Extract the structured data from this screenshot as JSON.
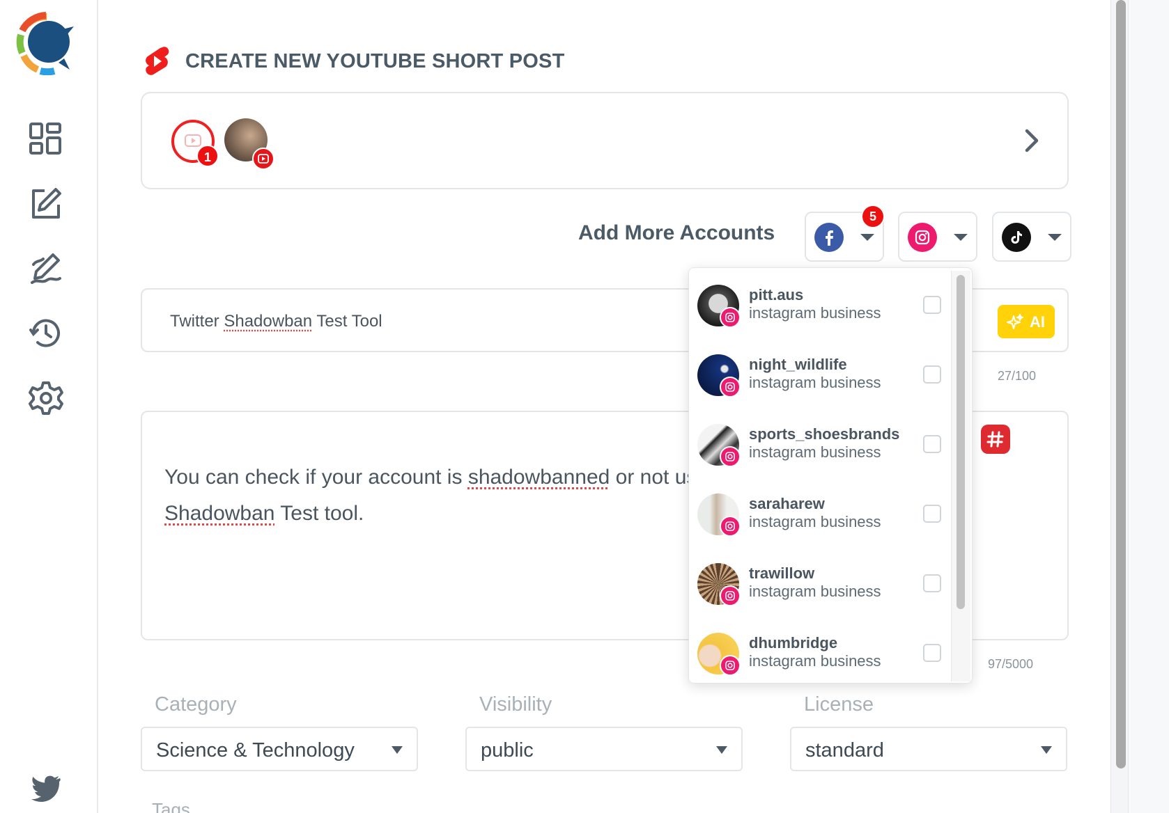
{
  "sidebar": {
    "icons": [
      "dashboard-icon",
      "compose-icon",
      "drafts-icon",
      "history-icon",
      "settings-icon",
      "twitter-icon"
    ]
  },
  "header": {
    "title": "CREATE NEW YOUTUBE SHORT POST"
  },
  "selected_accounts": {
    "youtube_count": "1"
  },
  "add_more": {
    "label": "Add More Accounts",
    "facebook_badge": "5"
  },
  "title_field": {
    "prefix": "Twitter ",
    "misspelled": "Shadowban",
    "suffix": " Test Tool",
    "count": "27/100",
    "ai_label": "AI"
  },
  "description": {
    "line1_prefix": "You can check if your account is ",
    "line1_misspelled": "shadowbanned",
    "line1_suffix": " or not using Twitter",
    "line2_misspelled": "Shadowban",
    "line2_suffix": " Test tool.",
    "count": "97/5000"
  },
  "fields": {
    "category_label": "Category",
    "category_value": "Science & Technology",
    "visibility_label": "Visibility",
    "visibility_value": "public",
    "license_label": "License",
    "license_value": "standard",
    "tags_label": "Tags"
  },
  "dropdown": {
    "accounts": [
      {
        "name": "pitt.aus",
        "type": "instagram business",
        "checked": false
      },
      {
        "name": "night_wildlife",
        "type": "instagram business",
        "checked": false
      },
      {
        "name": "sports_shoesbrands",
        "type": "instagram business",
        "checked": false
      },
      {
        "name": "saraharew",
        "type": "instagram business",
        "checked": false
      },
      {
        "name": "trawillow",
        "type": "instagram business",
        "checked": false
      },
      {
        "name": "dhumbridge",
        "type": "instagram business",
        "checked": false
      }
    ]
  },
  "colors": {
    "youtube_red": "#e6151a",
    "facebook_blue": "#3b5aa8",
    "instagram_pink": "#ee1a6e",
    "ai_yellow": "#ffd20a",
    "text_dark": "#4a5a66"
  }
}
